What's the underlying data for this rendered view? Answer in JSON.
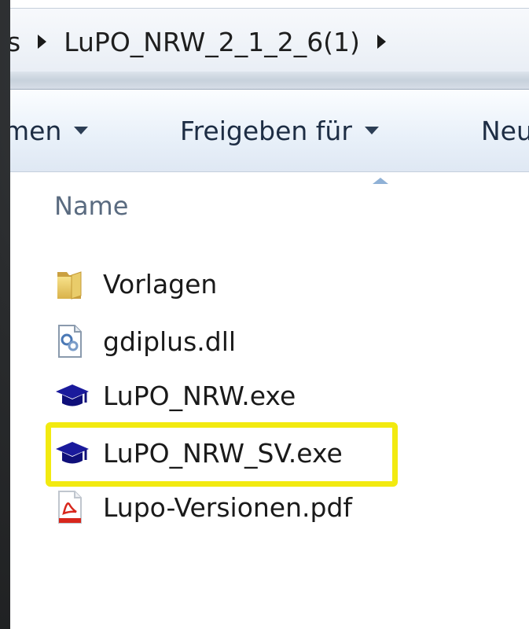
{
  "address_bar": {
    "prev_crumb": "s",
    "current_folder": "LuPO_NRW_2_1_2_6(1)"
  },
  "toolbar": {
    "items": [
      {
        "label": "men"
      },
      {
        "label": "Freigeben für"
      },
      {
        "label": "Neu"
      }
    ]
  },
  "list": {
    "column_header": "Name",
    "files": [
      {
        "name": "Vorlagen",
        "icon": "folder-icon"
      },
      {
        "name": "gdiplus.dll",
        "icon": "dll-file-icon"
      },
      {
        "name": "LuPO_NRW.exe",
        "icon": "graduation-cap-icon"
      },
      {
        "name": "LuPO_NRW_SV.exe",
        "icon": "graduation-cap-icon"
      },
      {
        "name": "Lupo-Versionen.pdf",
        "icon": "pdf-file-icon"
      }
    ]
  },
  "colors": {
    "highlight": "#f2ea10",
    "toolbar_text": "#1d2d44",
    "header_text": "#5a6b80"
  }
}
